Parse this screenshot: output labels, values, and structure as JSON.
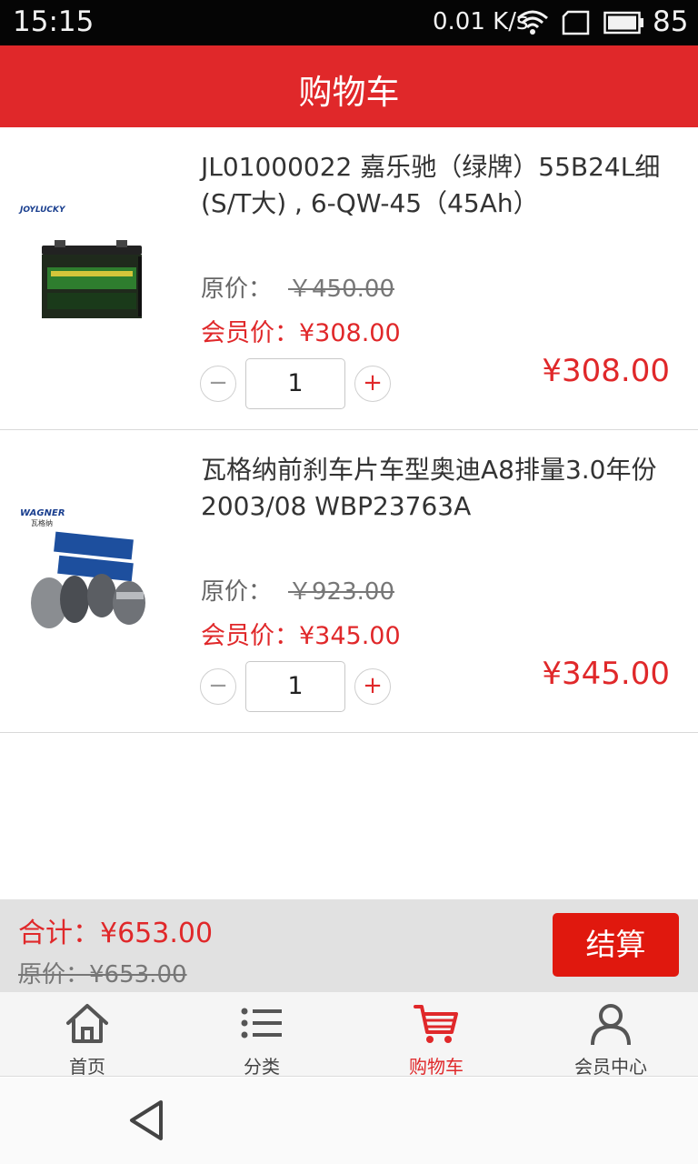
{
  "status_bar": {
    "time": "15:15",
    "speed": "0.01 K/s",
    "battery_percent": "85"
  },
  "header": {
    "title": "购物车"
  },
  "cart_items": [
    {
      "name": "JL01000022 嘉乐驰（绿牌）55B24L细(S/T大) , 6-QW-45（45Ah）",
      "original_price_label": "原价：",
      "original_price": "￥450.00",
      "member_price_label": "会员价：",
      "member_price": "¥308.00",
      "quantity": "1",
      "line_total": "¥308.00",
      "brand_logo_text": "JOYLUCKY",
      "image_icon": "car-battery-icon"
    },
    {
      "name": "瓦格纳前刹车片车型奥迪A8排量3.0年份2003/08 WBP23763A",
      "original_price_label": "原价：",
      "original_price": "￥923.00",
      "member_price_label": "会员价：",
      "member_price": "¥345.00",
      "quantity": "1",
      "line_total": "¥345.00",
      "brand_logo_text": "WAGNER",
      "brand_logo_subtext": "瓦格纳",
      "image_icon": "brake-pads-icon"
    }
  ],
  "summary": {
    "total_label": "合计：",
    "total_value": "¥653.00",
    "original_label": "原价：",
    "original_value": "¥653.00",
    "checkout_label": "结算"
  },
  "bottom_nav": [
    {
      "label": "首页",
      "icon": "home-icon",
      "active": false
    },
    {
      "label": "分类",
      "icon": "list-icon",
      "active": false
    },
    {
      "label": "购物车",
      "icon": "cart-icon",
      "active": true
    },
    {
      "label": "会员中心",
      "icon": "user-icon",
      "active": false
    }
  ],
  "colors": {
    "accent": "#e0282a",
    "checkout": "#e0180e",
    "summary_bg": "#e1e1e1",
    "nav_bg": "#f5f5f5"
  }
}
